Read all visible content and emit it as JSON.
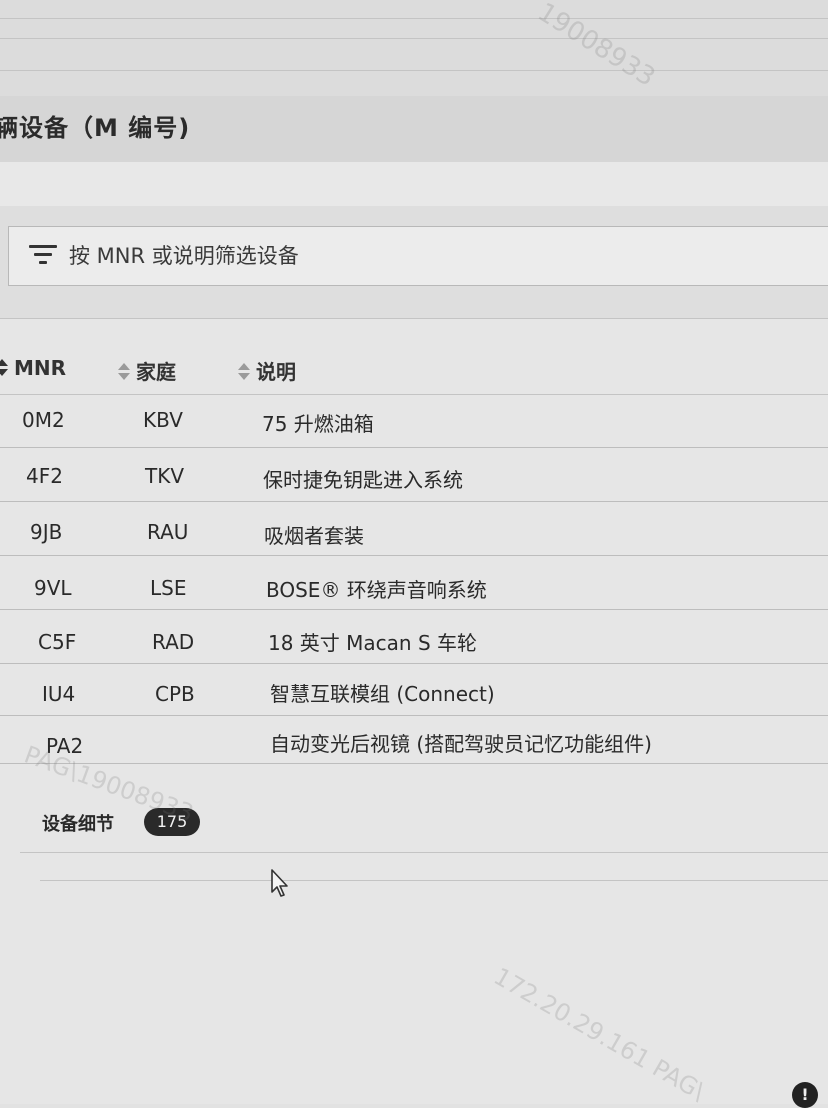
{
  "section_title": "辆设备（M 编号)",
  "filter": {
    "placeholder": "按 MNR 或说明筛选设备"
  },
  "table": {
    "columns": [
      "MNR",
      "家庭",
      "说明"
    ],
    "rows": [
      {
        "mnr": "0M2",
        "family": "KBV",
        "description": "75 升燃油箱"
      },
      {
        "mnr": "4F2",
        "family": "TKV",
        "description": "保时捷免钥匙进入系统"
      },
      {
        "mnr": "9JB",
        "family": "RAU",
        "description": "吸烟者套装"
      },
      {
        "mnr": "9VL",
        "family": "LSE",
        "description": "BOSE® 环绕声音响系统"
      },
      {
        "mnr": "C5F",
        "family": "RAD",
        "description": "18 英寸 Macan S 车轮"
      },
      {
        "mnr": "IU4",
        "family": "CPB",
        "description": "智慧互联模组 (Connect)"
      },
      {
        "mnr": "PA2",
        "family": "",
        "description": "自动变光后视镜 (搭配驾驶员记忆功能组件)"
      }
    ]
  },
  "details": {
    "label": "设备细节",
    "count": "175"
  },
  "watermarks": {
    "top": "19008933",
    "middle": "PAG\\19008933",
    "bottom": "172.20.29.161  PAG\\"
  },
  "icons": {
    "filter": "filter-icon",
    "sort": "sort-arrows-icon",
    "cursor": "mouse-pointer-icon",
    "info": "info-icon"
  }
}
